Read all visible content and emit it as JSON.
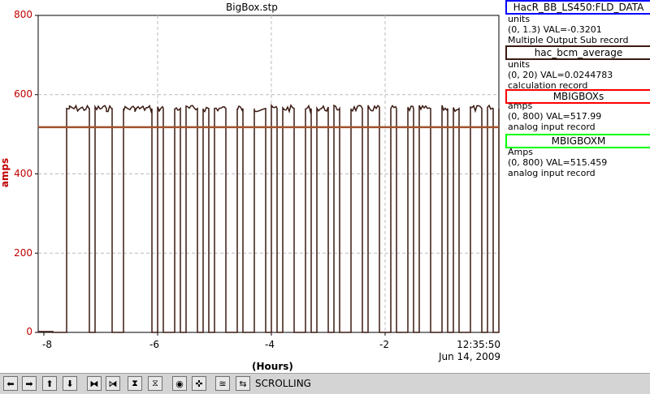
{
  "chart_data": {
    "type": "line",
    "title": "BigBox.stp",
    "ylabel": "amps",
    "xlabel": "(Hours)",
    "ylim": [
      0,
      800
    ],
    "xlim": [
      -8.1,
      0
    ],
    "yticks": [
      "0",
      "200",
      "400",
      "600",
      "800"
    ],
    "xticks": [
      "-8",
      "-6",
      "-4",
      "-2"
    ],
    "timestamp_time": "12:35:50",
    "timestamp_date": "Jun 14, 2009",
    "grid": true,
    "series": [
      {
        "name": "MBIGBOXs",
        "color": "#3a1a12",
        "style": "noisy-step",
        "x": [
          -8.1,
          -7.85,
          -7.84,
          -7.6,
          -7.55,
          -7.2,
          -7.1,
          -6.9,
          -6.8,
          -6.6,
          -6.4,
          -6.1,
          -6.0,
          -5.9,
          -5.7,
          -5.6,
          -5.5,
          -5.3,
          -5.2,
          -5.1,
          -5.0,
          -4.8,
          -4.6,
          -4.5,
          -4.3,
          -4.1,
          -4.0,
          -3.9,
          -3.8,
          -3.6,
          -3.4,
          -3.3,
          -3.2,
          -3.0,
          -2.9,
          -2.8,
          -2.6,
          -2.4,
          -2.3,
          -2.1,
          -1.9,
          -1.8,
          -1.6,
          -1.5,
          -1.4,
          -1.2,
          -1.0,
          -0.9,
          -0.8,
          -0.7,
          -0.5,
          -0.3,
          -0.2,
          -0.1,
          0
        ],
        "y": [
          2,
          2,
          0,
          565,
          565,
          0,
          565,
          565,
          0,
          565,
          565,
          0,
          565,
          0,
          565,
          0,
          565,
          0,
          565,
          0,
          565,
          0,
          565,
          0,
          565,
          0,
          565,
          0,
          565,
          0,
          565,
          0,
          565,
          0,
          565,
          0,
          565,
          0,
          565,
          0,
          565,
          0,
          565,
          0,
          565,
          0,
          565,
          0,
          565,
          0,
          565,
          0,
          565,
          0,
          565
        ]
      },
      {
        "name": "MBIGBOXM",
        "color": "#a0522d",
        "style": "flat",
        "x": [
          -8.1,
          0
        ],
        "y": [
          518,
          518
        ]
      }
    ]
  },
  "legend": [
    {
      "name": "HacR_BB_LS450:FLD_DATA",
      "color": "#0000ff",
      "units": "units",
      "range": "(0, 1.3) VAL=-0.3201",
      "record": "Multiple Output Sub record"
    },
    {
      "name": "hac_bcm_average",
      "color": "#3a1a12",
      "units": "units",
      "range": "(0, 20) VAL=0.0244783",
      "record": "calculation record"
    },
    {
      "name": "MBIGBOXs",
      "color": "#ff0000",
      "units": "amps",
      "range": "(0, 800) VAL=517.99",
      "record": "analog input record"
    },
    {
      "name": "MBIGBOXM",
      "color": "#00ff00",
      "units": "Amps",
      "range": "(0, 800) VAL=515.459",
      "record": "analog input record"
    }
  ],
  "toolbar": {
    "status": "SCROLLING",
    "buttons": [
      "arrow-left-icon",
      "arrow-right-icon",
      "arrow-up-icon",
      "arrow-down-icon",
      "zoom-in-horizontal-icon",
      "zoom-out-horizontal-icon",
      "zoom-in-vertical-icon",
      "zoom-out-vertical-icon",
      "record-icon",
      "pan-icon",
      "autoscale-icon",
      "scroll-icon"
    ],
    "glyphs": [
      "⬅",
      "➡",
      "⬆",
      "⬇",
      "⧓",
      "⧒",
      "⧗",
      "⧖",
      "◉",
      "✜",
      "≊",
      "⇆"
    ]
  }
}
